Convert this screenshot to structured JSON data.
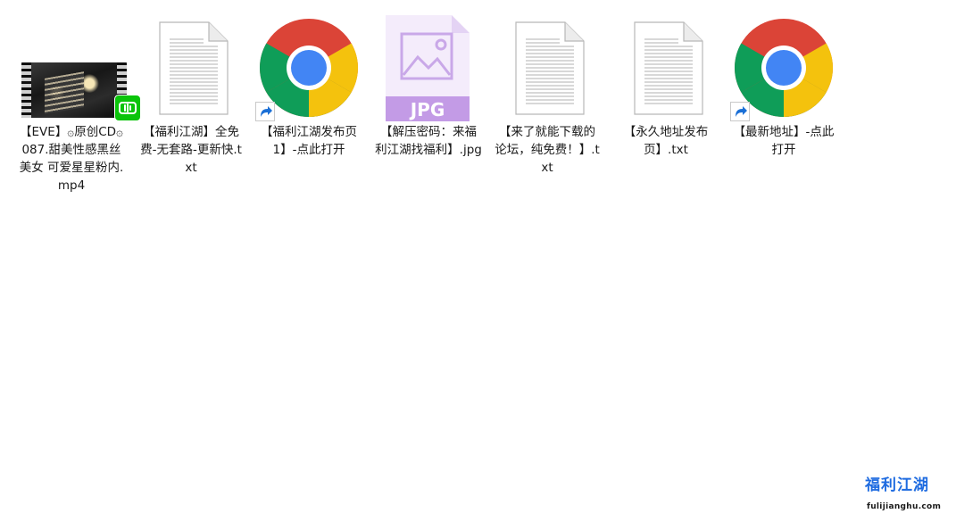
{
  "files": [
    {
      "name": "【EVE】۞原创CD۞087.甜美性感黑丝美女 可爱星星粉内.mp4",
      "type": "video"
    },
    {
      "name": "【福利江湖】全免费-无套路-更新快.txt",
      "type": "text"
    },
    {
      "name": "【福利江湖发布页1】-点此打开",
      "type": "chrome-shortcut"
    },
    {
      "name": "【解压密码：来福利江湖找福利】.jpg",
      "type": "jpg",
      "badge_text": "JPG"
    },
    {
      "name": "【来了就能下载的论坛，纯免费！】.txt",
      "type": "text"
    },
    {
      "name": "【永久地址发布页】.txt",
      "type": "text"
    },
    {
      "name": "【最新地址】-点此打开",
      "type": "chrome-shortcut"
    }
  ],
  "watermark": {
    "title": "福利江湖",
    "url": "fulijianghu.com"
  },
  "colors": {
    "chrome_red": "#db4437",
    "chrome_yellow": "#f4c20d",
    "chrome_green": "#0f9d58",
    "chrome_blue": "#4285f4",
    "jpg_purple": "#c39be6",
    "media_green": "#0ac40a",
    "shortcut_blue": "#1a6fd6"
  },
  "icons": {
    "video": "video-thumbnail-icon",
    "text": "text-document-icon",
    "chrome": "chrome-icon",
    "jpg": "jpg-file-icon",
    "shortcut": "shortcut-arrow-icon"
  }
}
